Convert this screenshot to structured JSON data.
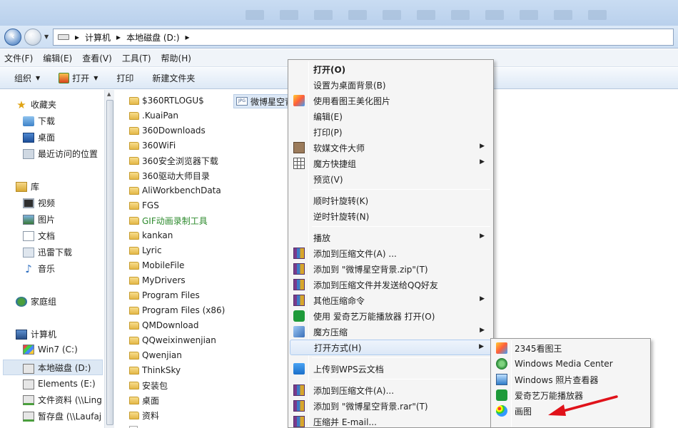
{
  "address": {
    "segments": [
      "计算机",
      "本地磁盘 (D:)"
    ],
    "separator": "▸"
  },
  "menubar": [
    "文件(F)",
    "编辑(E)",
    "查看(V)",
    "工具(T)",
    "帮助(H)"
  ],
  "toolbar": {
    "organize": "组织",
    "open": "打开",
    "print": "打印",
    "new_folder": "新建文件夹"
  },
  "nav": {
    "favorites": {
      "header": "收藏夹",
      "items": [
        "下载",
        "桌面",
        "最近访问的位置"
      ]
    },
    "libraries": {
      "header": "库",
      "items": [
        "视频",
        "图片",
        "文档",
        "迅雷下载",
        "音乐"
      ]
    },
    "homegroup": "家庭组",
    "computer": {
      "header": "计算机",
      "items": [
        "Win7 (C:)",
        "本地磁盘 (D:)",
        "Elements (E:)",
        "文件资料 (\\\\Ling",
        "暂存盘 (\\\\Laufaj"
      ]
    }
  },
  "files": [
    "$360RTLOGU$",
    ".KuaiPan",
    "360Downloads",
    "360WiFi",
    "360安全浏览器下载",
    "360驱动大师目录",
    "AliWorkbenchData",
    "FGS",
    "GIF动画录制工具",
    "kankan",
    "Lyric",
    "MobileFile",
    "MyDrivers",
    "Program Files",
    "Program Files (x86)",
    "QMDownload",
    "QQweixinwenjian",
    "Qwenjian",
    "ThinkSky",
    "安装包",
    "桌面",
    "资料"
  ],
  "selected_file": {
    "name": "微博星空背",
    "ext_badge": "JPG"
  },
  "context_menu": [
    {
      "label": "打开(O)",
      "icon": "",
      "arrow": false,
      "bold": true
    },
    {
      "label": "设置为桌面背景(B)",
      "icon": "",
      "arrow": false
    },
    {
      "label": "使用看图王美化图片",
      "icon": "pic2345-icon",
      "arrow": false
    },
    {
      "label": "编辑(E)",
      "icon": "",
      "arrow": false
    },
    {
      "label": "打印(P)",
      "icon": "",
      "arrow": false
    },
    {
      "label": "软媒文件大师",
      "icon": "softmedia-icon",
      "arrow": true
    },
    {
      "label": "魔方快捷组",
      "icon": "grid-icon",
      "arrow": true
    },
    {
      "label": "预览(V)",
      "icon": "",
      "arrow": false
    },
    {
      "label": "顺时针旋转(K)",
      "icon": "",
      "arrow": false
    },
    {
      "label": "逆时针旋转(N)",
      "icon": "",
      "arrow": false
    },
    {
      "label": "播放",
      "icon": "",
      "arrow": true
    },
    {
      "label": "添加到压缩文件(A) ...",
      "icon": "winrar-icon",
      "arrow": false
    },
    {
      "label": "添加到 \"微博星空背景.zip\"(T)",
      "icon": "winrar-icon",
      "arrow": false
    },
    {
      "label": "添加到压缩文件并发送给QQ好友",
      "icon": "winrar-icon",
      "arrow": false
    },
    {
      "label": "其他压缩命令",
      "icon": "winrar-icon",
      "arrow": true
    },
    {
      "label": "使用 爱奇艺万能播放器 打开(O)",
      "icon": "aiqiyi-icon",
      "arrow": false
    },
    {
      "label": "魔方压缩",
      "icon": "cube-icon",
      "arrow": true
    },
    {
      "label": "打开方式(H)",
      "icon": "",
      "arrow": true,
      "highlight": true
    },
    {
      "label": "上传到WPS云文档",
      "icon": "wps-cloud-icon",
      "arrow": false
    },
    {
      "label": "添加到压缩文件(A)...",
      "icon": "winrar-icon",
      "arrow": false
    },
    {
      "label": "添加到 \"微博星空背景.rar\"(T)",
      "icon": "winrar-icon",
      "arrow": false
    },
    {
      "label": "压缩并 E-mail...",
      "icon": "winrar-icon",
      "arrow": false
    }
  ],
  "open_with_submenu": [
    {
      "label": "2345看图王",
      "icon": "pic2345-icon"
    },
    {
      "label": "Windows Media Center",
      "icon": "media-center-icon"
    },
    {
      "label": "Windows 照片查看器",
      "icon": "photo-viewer-icon"
    },
    {
      "label": "爱奇艺万能播放器",
      "icon": "aiqiyi-icon"
    },
    {
      "label": "画图",
      "icon": "paint-icon"
    }
  ],
  "annotation_color": "#e0121a"
}
